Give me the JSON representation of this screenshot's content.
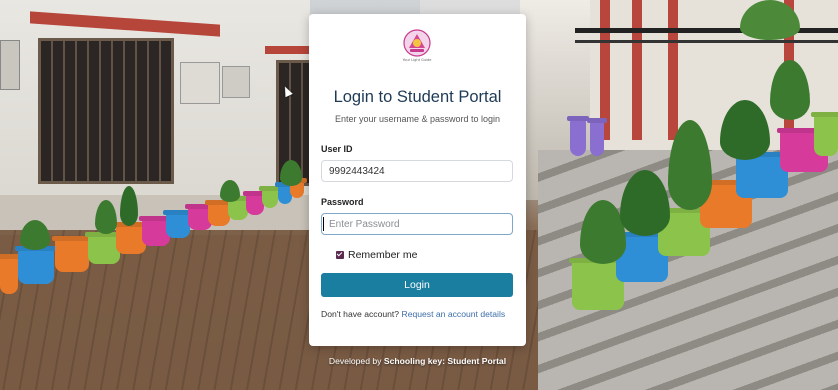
{
  "brand": {
    "logo_icon": "school-crest-icon",
    "logo_tagline": "Your Light Guide"
  },
  "login": {
    "title": "Login to Student Portal",
    "subtitle": "Enter your username & password to login",
    "user_label": "User ID",
    "user_value": "9992443424",
    "password_label": "Password",
    "password_placeholder": "Enter Password",
    "remember_label": "Remember me",
    "remember_checked": true,
    "submit_label": "Login",
    "no_account_text": "Don't have account?",
    "request_link": "Request an account details"
  },
  "footer": {
    "prefix": "Developed by",
    "brand": "Schooling key: Student Portal"
  },
  "colors": {
    "primary_button": "#1a7ea0",
    "title": "#1f3a55",
    "link": "#3d6ea8",
    "checkbox": "#5b2a4f"
  }
}
